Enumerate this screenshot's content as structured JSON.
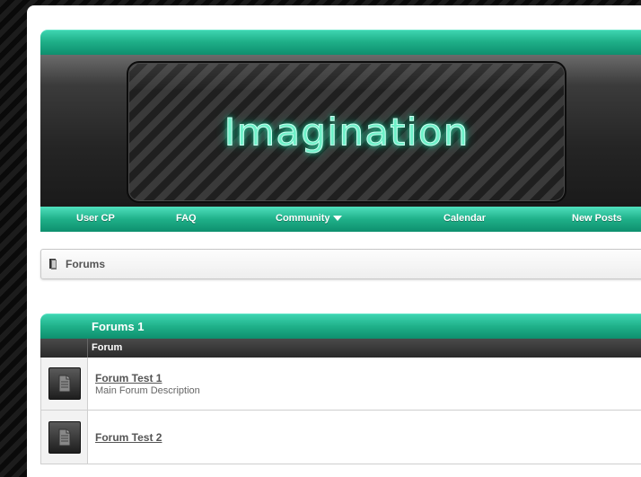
{
  "header": {
    "logo_text": "Imagination"
  },
  "navbar": {
    "items": [
      {
        "label": "User CP"
      },
      {
        "label": "FAQ"
      },
      {
        "label": "Community"
      },
      {
        "label": "Calendar"
      },
      {
        "label": "New Posts"
      }
    ]
  },
  "breadcrumb": {
    "label": "Forums"
  },
  "forum_block": {
    "title": "Forums 1",
    "column_header": "Forum",
    "forums": [
      {
        "title": "Forum Test 1",
        "description": "Main Forum Description",
        "icon": "document-icon"
      },
      {
        "title": "Forum Test 2",
        "description": "",
        "icon": "document-icon"
      }
    ]
  },
  "colors": {
    "accent": "#1fb089",
    "dark": "#252525"
  }
}
